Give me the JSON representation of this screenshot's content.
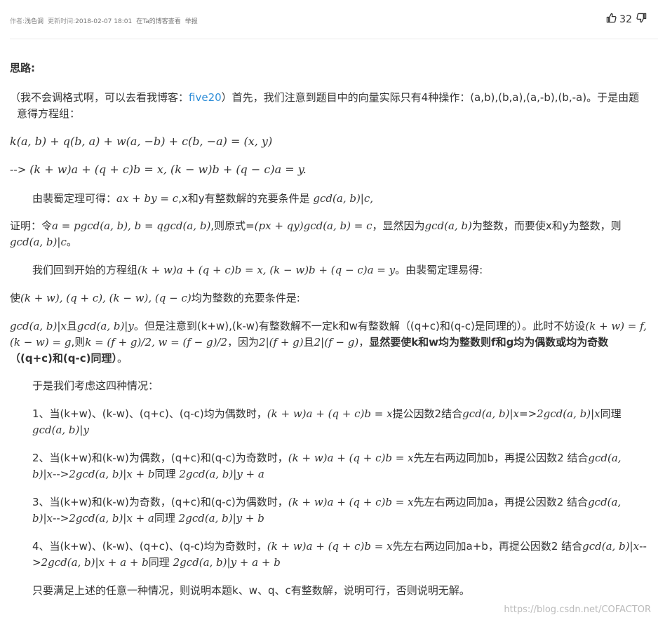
{
  "meta": {
    "author_label": "作者:",
    "author": "浅色调",
    "updated_label": "更新时间:",
    "updated": "2018-02-07 18:01",
    "blog_link": "在Ta的博客查看",
    "report_link": "举报"
  },
  "votes": {
    "count": "32"
  },
  "body": {
    "heading": "思路:",
    "p1a": "（我不会调格式啊，可以去看我博客：",
    "p1_link": "five20",
    "p1b": "）首先，我们注意到题目中的向量实际只有4种操作：(a,b),(b,a),(a,-b),(b,-a)。于是由题意得方程组：",
    "eq1": "k(a, b) + q(b, a) + w(a, −b) + c(b, −a) = (x, y)",
    "eq2_prefix": "-->",
    "eq2": "(k + w)a + (q + c)b = x, (k − w)b + (q − c)a = y.",
    "p3a": "由裴蜀定理可得：",
    "p3_eq": "ax + by = c",
    "p3b": ",x和y有整数解的充要条件是",
    "p3_eq2": "gcd(a, b)|c,",
    "p4a": "证明：令",
    "p4_eq1": "a = pgcd(a, b), b = qgcd(a, b)",
    "p4b": ",则原式=",
    "p4_eq2": "(px + qy)gcd(a, b) = c",
    "p4c": "，显然因为",
    "p4_eq3": "gcd(a, b)",
    "p4d": "为整数，而要使x和y为整数，则",
    "p4_eq4": "gcd(a, b)|c",
    "p4e": "。",
    "p5a": "我们回到开始的方程组",
    "p5_eq": "(k + w)a + (q + c)b = x, (k − w)b + (q − c)a = y",
    "p5b": "。由裴蜀定理易得:",
    "p6a": "使",
    "p6_eq": "(k + w), (q + c), (k − w), (q − c)",
    "p6b": "均为整数的充要条件是:",
    "p7_eq1": "gcd(a, b)|x",
    "p7a": "且",
    "p7_eq2": "gcd(a, b)|y",
    "p7b": "。但是注意到(k+w),(k-w)有整数解不一定k和w有整数解（(q+c)和(q-c)是同理的）。此时不妨设",
    "p7_eq3": "(k + w) = f, (k − w) = g",
    "p7c": ",则",
    "p7_eq4": "k = (f + g)/2, w = (f − g)/2",
    "p7d": "，因为",
    "p7_eq5": "2|(f + g)",
    "p7e": "且",
    "p7_eq6": "2|(f − g)",
    "p7f": "，",
    "p7_bold": "显然要使k和w均为整数则f和g均为偶数或均为奇数（(q+c)和(q-c)同理）",
    "p7g": "。",
    "p8": "于是我们考虑这四种情况：",
    "c1a": "1、当(k+w)、(k-w)、(q+c)、(q-c)均为偶数时，",
    "c1_eq1": "(k + w)a + (q + c)b = x",
    "c1b": "提公因数2结合",
    "c1_eq2": "gcd(a, b)|x",
    "c1c": "=>",
    "c1_eq3": "2gcd(a, b)|x",
    "c1d": "同理",
    "c1_eq4": "gcd(a, b)|y",
    "c2a": "2、当(k+w)和(k-w)为偶数，(q+c)和(q-c)为奇数时，",
    "c2_eq1": "(k + w)a + (q + c)b = x",
    "c2b": "先左右两边同加b，再提公因数2 结合",
    "c2_eq2": "gcd(a, b)|x",
    "c2c": "-->",
    "c2_eq3": "2gcd(a, b)|x + b",
    "c2d": "同理",
    "c2_eq4": "2gcd(a, b)|y + a",
    "c3a": "3、当(k+w)和(k-w)为奇数，(q+c)和(q-c)为偶数时，",
    "c3_eq1": "(k + w)a + (q + c)b = x",
    "c3b": "先左右两边同加a，再提公因数2 结合",
    "c3_eq2": "gcd(a, b)|x",
    "c3c": "-->",
    "c3_eq3": "2gcd(a, b)|x + a",
    "c3d": "同理",
    "c3_eq4": "2gcd(a, b)|y + b",
    "c4a": "4、当(k+w)、(k-w)、(q+c)、(q-c)均为奇数时，",
    "c4_eq1": "(k + w)a + (q + c)b = x",
    "c4b": "先左右两边同加a+b，再提公因数2 结合",
    "c4_eq2": "gcd(a, b)|x",
    "c4c": "-->",
    "c4_eq3": "2gcd(a, b)|x + a + b",
    "c4d": "同理",
    "c4_eq4": "2gcd(a, b)|y + a + b",
    "p9": "只要满足上述的任意一种情况，则说明本题k、w、q、c有整数解，说明可行，否则说明无解。"
  },
  "watermark": "https://blog.csdn.net/COFACTOR"
}
